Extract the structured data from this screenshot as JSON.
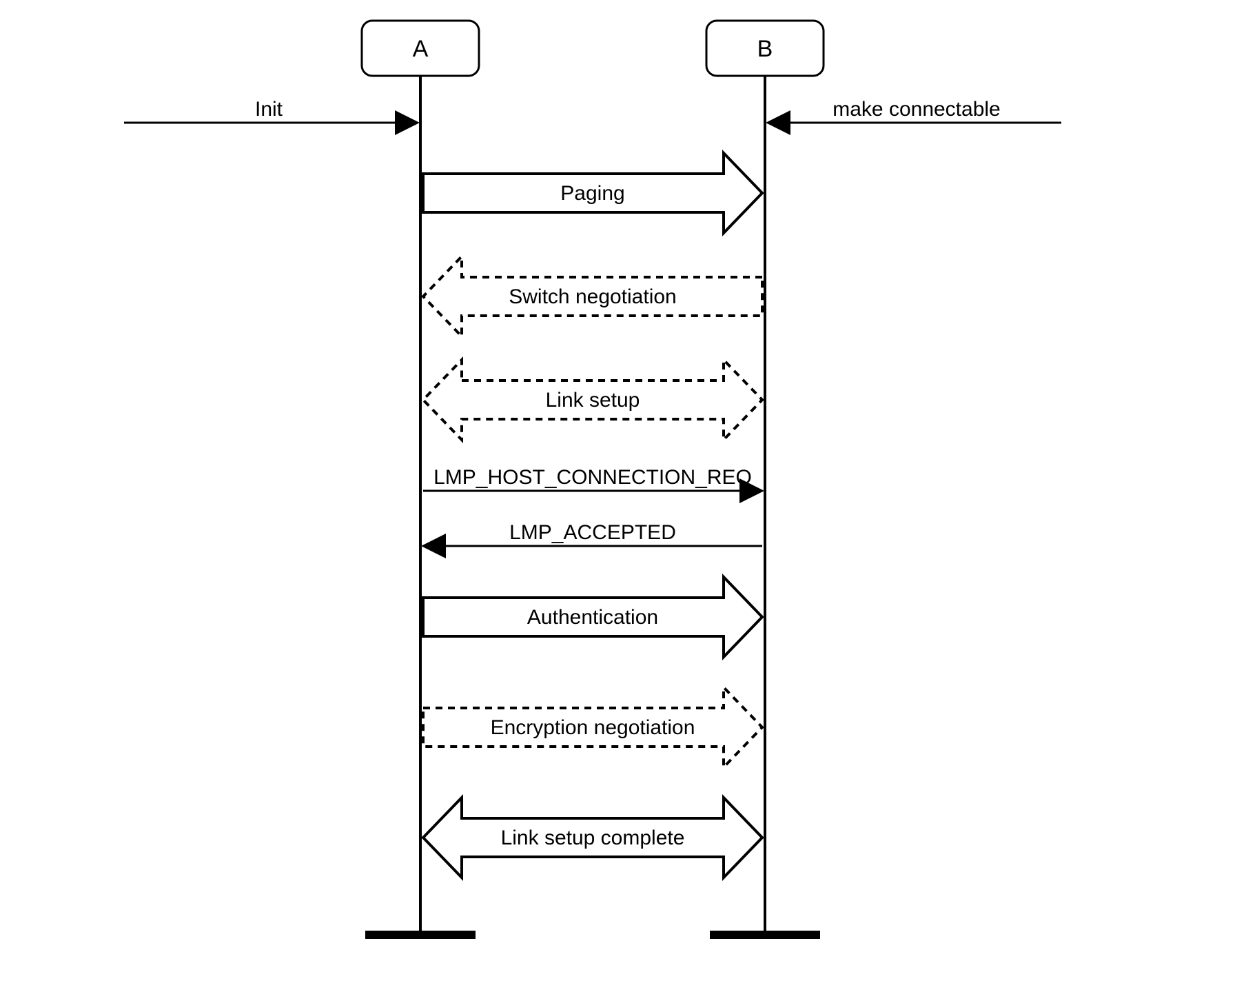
{
  "actors": {
    "A": "A",
    "B": "B"
  },
  "external": {
    "left": "Init",
    "right": "make connectable"
  },
  "messages": {
    "paging": "Paging",
    "switch_neg": "Switch negotiation",
    "link_setup": "Link setup",
    "host_conn_req": "LMP_HOST_CONNECTION_REQ",
    "accepted": "LMP_ACCEPTED",
    "auth": "Authentication",
    "enc_neg": "Encryption negotiation",
    "complete": "Link setup complete"
  }
}
